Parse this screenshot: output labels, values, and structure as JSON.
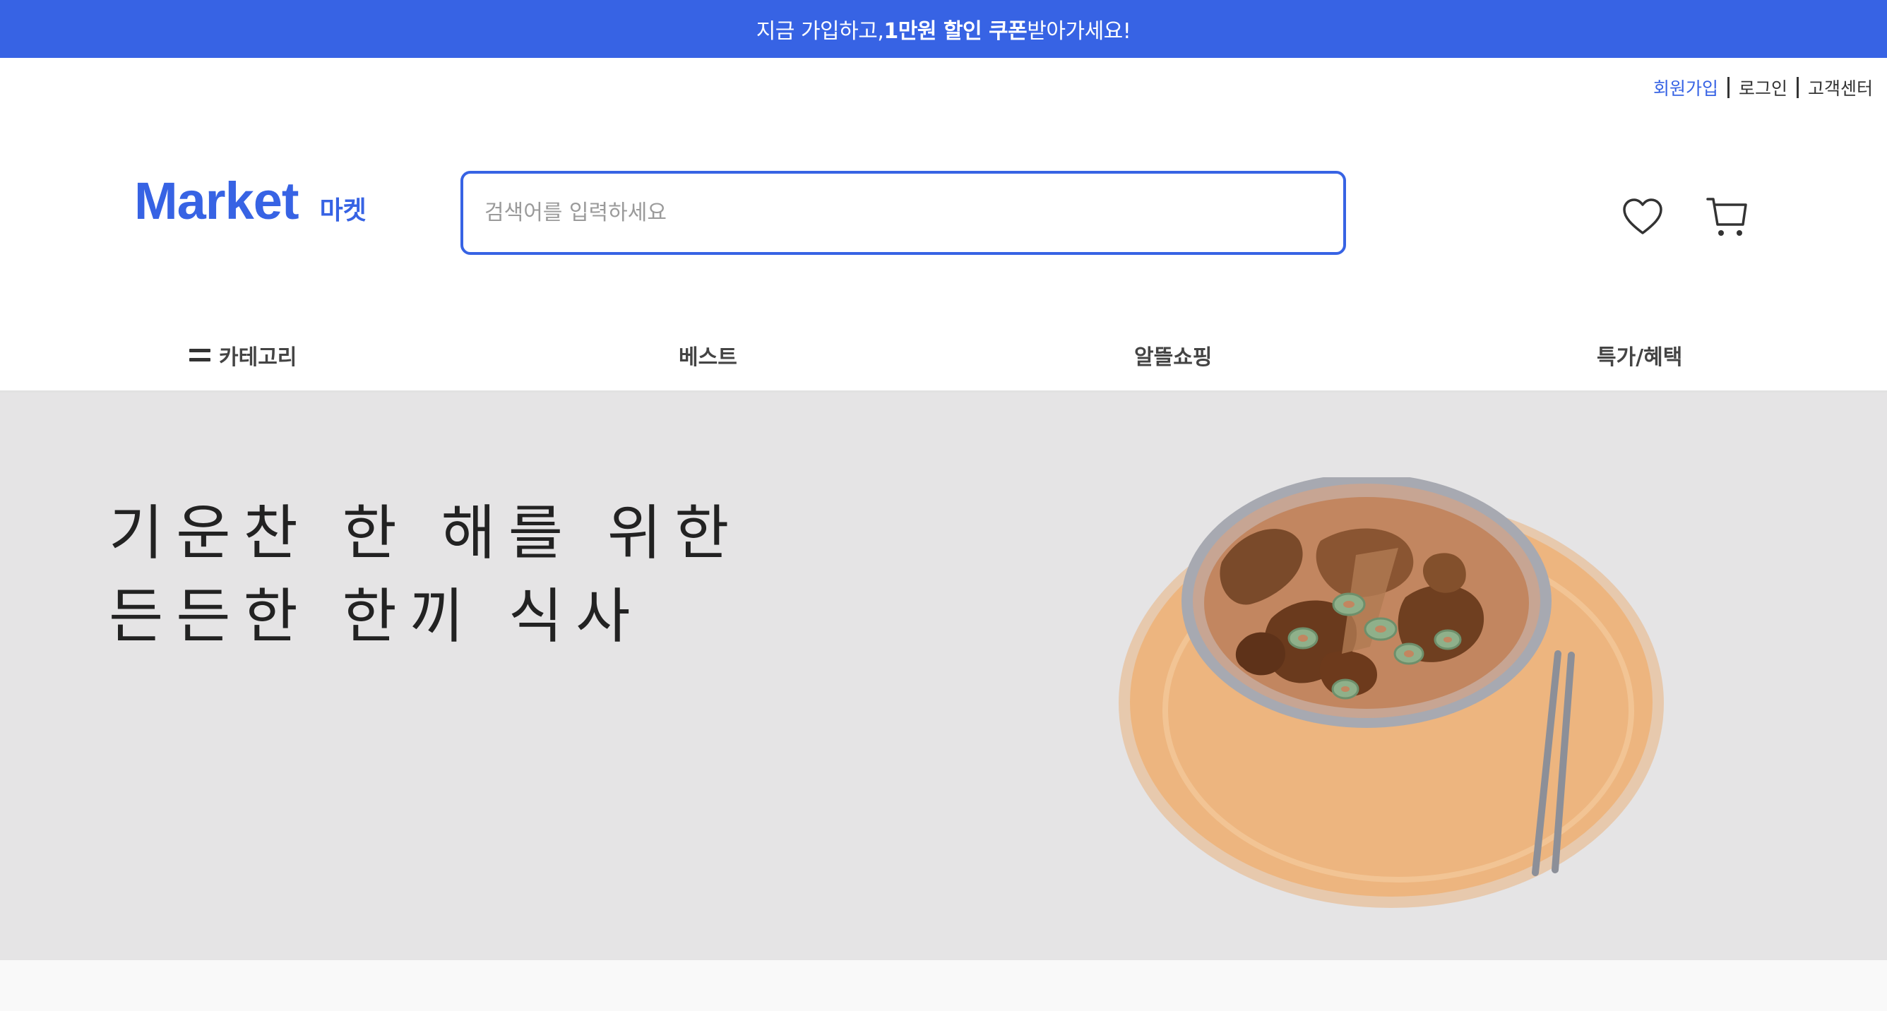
{
  "promo": {
    "prefix": "지금 가입하고, ",
    "highlight": "1만원 할인 쿠폰",
    "suffix": " 받아가세요!"
  },
  "util_links": {
    "join": "회원가입",
    "login": "로그인",
    "support": "고객센터"
  },
  "logo": {
    "main": "Market",
    "sub": "마켓"
  },
  "search": {
    "placeholder": "검색어를 입력하세요",
    "value": ""
  },
  "icons": {
    "wishlist": "heart-icon",
    "cart": "cart-icon",
    "category": "hamburger-icon"
  },
  "nav": {
    "category": "카테고리",
    "best": "베스트",
    "budget": "알뜰쇼핑",
    "deals": "특가/혜택"
  },
  "hero": {
    "line1": "기운찬 한 해를 위한",
    "line2": "든든한 한끼 식사"
  },
  "colors": {
    "brand": "#3763e4",
    "hero_bg": "#e5e4e5"
  }
}
